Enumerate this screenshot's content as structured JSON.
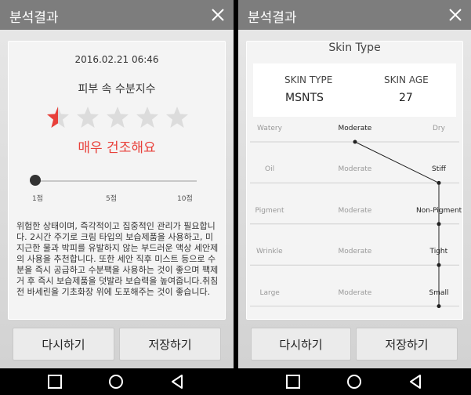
{
  "left": {
    "title": "분석결과",
    "date": "2016.02.21 06:46",
    "subtitle": "피부 속 수분지수",
    "rating": {
      "max": 5,
      "value": 0.5
    },
    "status": "매우 건조해요",
    "slider": {
      "value": 1,
      "min": 1,
      "max": 10,
      "ticks": [
        "1점",
        "5점",
        "10점"
      ]
    },
    "description": "위험한 상태이며, 즉각적이고 집중적인 관리가 필요합니다. 2시간 주기로 크림 타입의 보습제품을 사용하고, 미지근한 물과 박피를 유발하지 않는 부드러운 액상 세안제의 사용을 추천합니다. 또한 세안 직후 미스트 등으로 수분을 즉시 공급하고 수분팩을 사용하는 것이 좋으며 팩제거 후 즉시 보습제품을 덧발라 보습력을 높여줍니다.취침 전 바세린을 기초화장 위에 도포해주는 것이 좋습니다.",
    "buttons": {
      "retry": "다시하기",
      "save": "저장하기"
    }
  },
  "right": {
    "title": "분석결과",
    "heading": "Skin Type",
    "skin_type_label": "SKIN TYPE",
    "skin_type_value": "MSNTS",
    "skin_age_label": "SKIN AGE",
    "skin_age_value": "27",
    "rows": [
      {
        "left": "Watery",
        "mid": "Moderate",
        "right": "Dry",
        "selected": 1
      },
      {
        "left": "Oil",
        "mid": "Moderate",
        "right": "Stiff",
        "selected": 2
      },
      {
        "left": "Pigment",
        "mid": "Moderate",
        "right": "Non-Pigment",
        "selected": 2
      },
      {
        "left": "Wrinkle",
        "mid": "Moderate",
        "right": "Tight",
        "selected": 2
      },
      {
        "left": "Large",
        "mid": "Moderate",
        "right": "Small",
        "selected": 2
      }
    ],
    "buttons": {
      "retry": "다시하기",
      "save": "저장하기"
    }
  },
  "colors": {
    "titlebar": "#7d7d7d",
    "accent_red": "#e8403a",
    "selected_text": "#222222",
    "muted_text": "#999999"
  },
  "icons": {
    "close": "close-icon",
    "star": "star-icon",
    "nav_back": "back-icon",
    "nav_home": "home-icon",
    "nav_recent": "recent-apps-icon"
  }
}
